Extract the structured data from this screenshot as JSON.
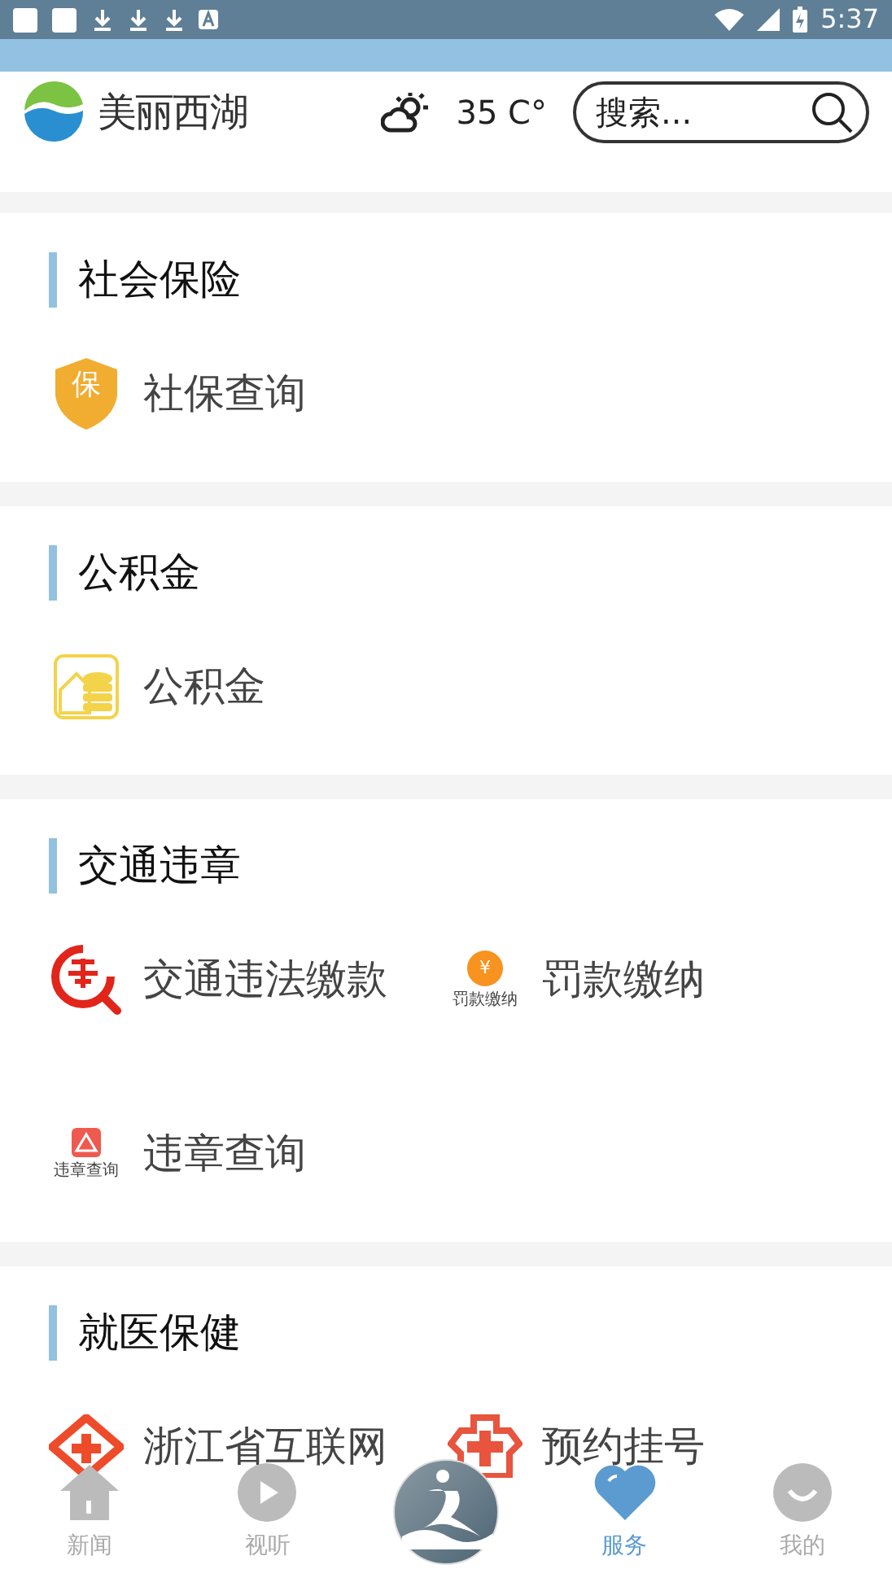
{
  "status_bar": {
    "time": "5:37"
  },
  "header": {
    "logo_text": "美丽西湖",
    "temperature": "35 C°",
    "search": {
      "placeholder": "搜索..."
    }
  },
  "sections": [
    {
      "title": "社会保险",
      "items": [
        {
          "kind": "shield",
          "icon_text": "保",
          "label": "社保查询"
        }
      ]
    },
    {
      "title": "公积金",
      "items": [
        {
          "kind": "fund",
          "label": "公积金"
        }
      ]
    },
    {
      "title": "交通违章",
      "items": [
        {
          "kind": "traffic",
          "label": "交通违法缴款"
        },
        {
          "kind": "fine",
          "icon_text": "¥",
          "caption": "罚款缴纳",
          "label": "罚款缴纳"
        },
        {
          "kind": "violation",
          "caption": "违章查询",
          "label": "违章查询"
        }
      ]
    },
    {
      "title": "就医保健",
      "items": [
        {
          "kind": "hospital",
          "label": "浙江省互联网"
        },
        {
          "kind": "registration",
          "label": "预约挂号"
        }
      ]
    }
  ],
  "nav": [
    {
      "kind": "home",
      "label": "新闻",
      "selected": false
    },
    {
      "kind": "play",
      "label": "视听",
      "selected": false
    },
    {
      "kind": "center"
    },
    {
      "kind": "heart",
      "label": "服务",
      "selected": true
    },
    {
      "kind": "smile",
      "label": "我的",
      "selected": false
    }
  ]
}
